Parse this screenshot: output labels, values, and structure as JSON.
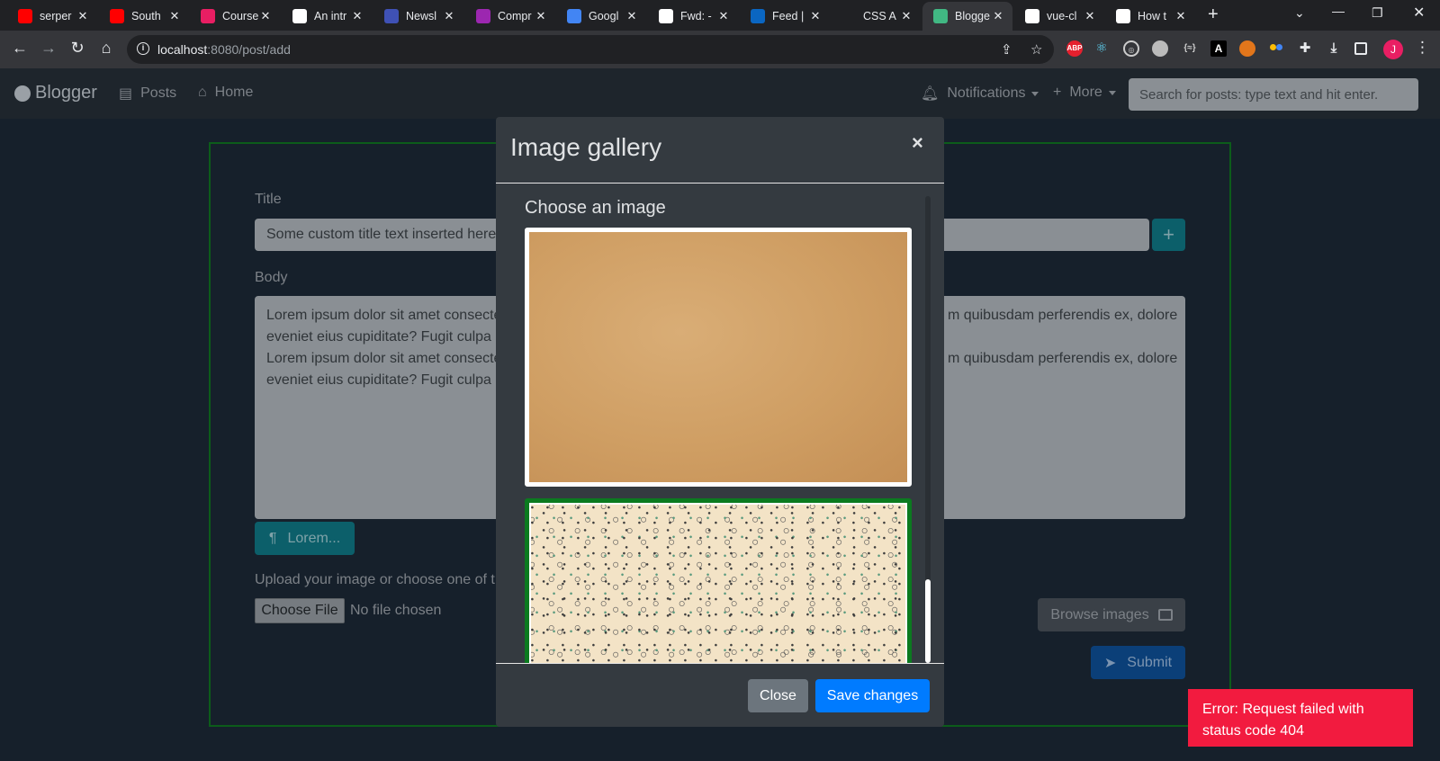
{
  "browser": {
    "tabs": [
      {
        "title": "serper",
        "favicon": "youtube-icon",
        "color": "#ff0000"
      },
      {
        "title": "South",
        "favicon": "youtube-icon",
        "color": "#ff0000"
      },
      {
        "title": "Course",
        "favicon": "course-icon",
        "color": "#e91e63"
      },
      {
        "title": "An intr",
        "favicon": "nr-icon",
        "color": "#ffffff"
      },
      {
        "title": "Newsl",
        "favicon": "newsletter-icon",
        "color": "#3f51b5"
      },
      {
        "title": "Compr",
        "favicon": "compress-icon",
        "color": "#9c27b0"
      },
      {
        "title": "Googl",
        "favicon": "google-translate-icon",
        "color": "#4285f4"
      },
      {
        "title": "Fwd: -",
        "favicon": "gmail-icon",
        "color": "#ffffff"
      },
      {
        "title": "Feed |",
        "favicon": "linkedin-icon",
        "color": "#0a66c2"
      },
      {
        "title": "CSS A",
        "favicon": "codepen-icon",
        "color": "#202124"
      },
      {
        "title": "Blogge",
        "favicon": "vue-icon",
        "color": "#41b883"
      },
      {
        "title": "vue-cl",
        "favicon": "google-icon",
        "color": "#ffffff"
      },
      {
        "title": "How t",
        "favicon": "code-icon",
        "color": "#ffffff"
      }
    ],
    "url_host": "localhost",
    "url_rest": ":8080/post/add",
    "profile_initial": "J"
  },
  "navbar": {
    "brand": "Blogger",
    "links": {
      "posts": "Posts",
      "home": "Home",
      "notifications": "Notifications",
      "more": "More"
    },
    "search_placeholder": "Search for posts: type text and hit enter."
  },
  "form": {
    "title_label": "Title",
    "title_value": "Some custom title text inserted here",
    "body_label": "Body",
    "body_value_left_1": "Lorem ipsum dolor sit amet consecte",
    "body_value_left_2": "eveniet eius cupiditate? Fugit culpa",
    "body_value_right_1": "m quibusdam perferendis ex, dolore",
    "lorem_button": "Lorem...",
    "upload_label": "Upload your image or choose one of t",
    "choose_file": "Choose File",
    "no_file": "No file chosen",
    "browse_button": "Browse images",
    "submit_button": "Submit"
  },
  "modal": {
    "title": "Image gallery",
    "close_x": "×",
    "subtitle": "Choose an image",
    "close_button": "Close",
    "save_button": "Save changes",
    "images": [
      {
        "description": "kraft paper texture",
        "selected": false
      },
      {
        "description": "confetti pattern",
        "selected": true
      }
    ]
  },
  "toast": {
    "message": "Error: Request failed with status code 404",
    "color": "#f21b3f"
  }
}
